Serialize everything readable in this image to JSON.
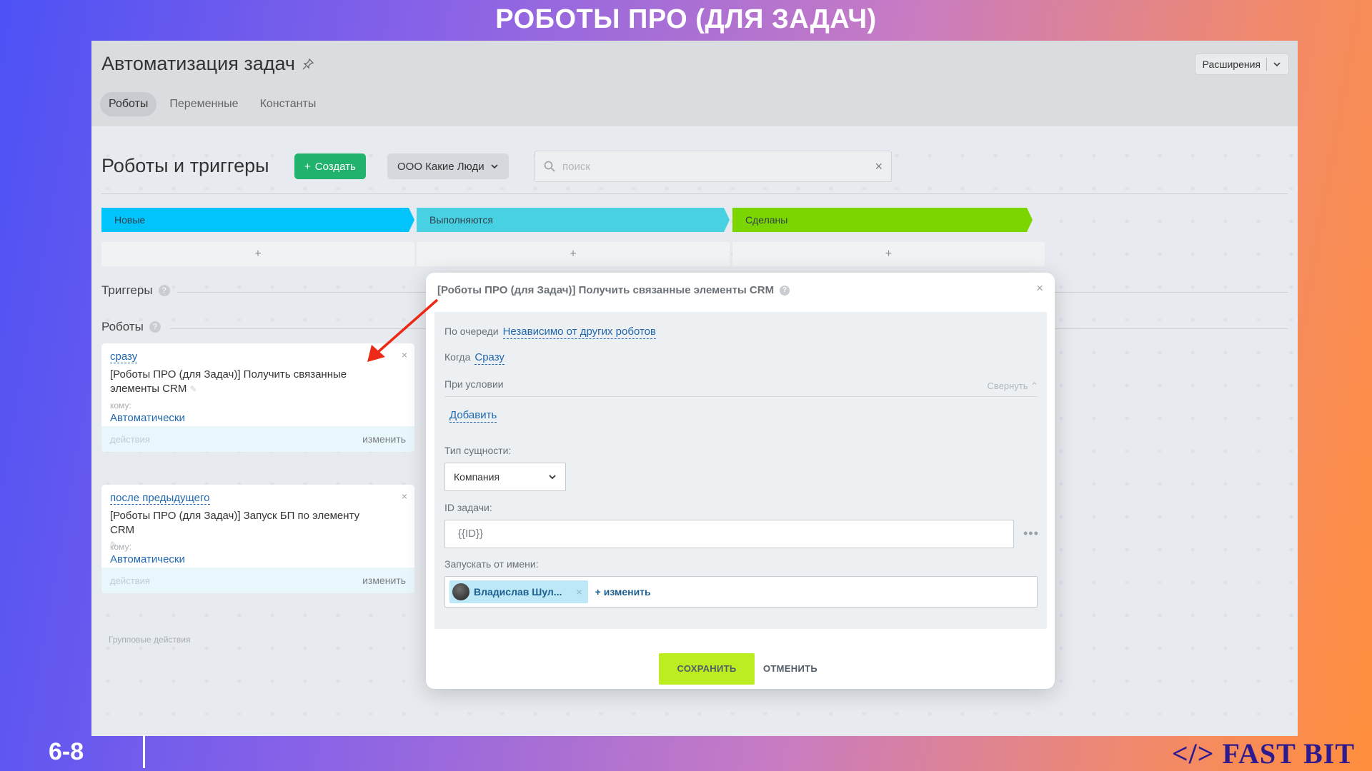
{
  "slide": {
    "title": "РОБОТЫ ПРО (ДЛЯ ЗАДАЧ)",
    "page_number": "6-8",
    "brand": "</> FAST BIT"
  },
  "header": {
    "title": "Автоматизация задач",
    "pin_icon": "pin-icon",
    "extensions_label": "Расширения"
  },
  "tabs": [
    {
      "label": "Роботы",
      "active": true
    },
    {
      "label": "Переменные"
    },
    {
      "label": "Константы"
    }
  ],
  "toolbar": {
    "heading": "Роботы и триггеры",
    "create_label": "Создать",
    "company_label": "ООО Какие Люди",
    "search_placeholder": "поиск"
  },
  "stages": [
    {
      "label": "Новые",
      "color": "#00c4fb"
    },
    {
      "label": "Выполняются",
      "color": "#47d1e2"
    },
    {
      "label": "Сделаны",
      "color": "#7bd500"
    }
  ],
  "add_symbol": "+",
  "sections": {
    "triggers": "Триггеры",
    "robots": "Роботы",
    "group_actions": "Групповые действия"
  },
  "robots": [
    {
      "when": "сразу",
      "name": "[Роботы ПРО (для Задач)] Получить связанные элементы CRM",
      "to_label": "кому:",
      "assignee": "Автоматически",
      "actions_label": "действия",
      "edit_label": "изменить"
    },
    {
      "when": "после предыдущего",
      "name": "[Роботы ПРО (для Задач)] Запуск БП по элементу CRM",
      "to_label": "кому:",
      "assignee": "Автоматически",
      "actions_label": "действия",
      "edit_label": "изменить"
    }
  ],
  "modal": {
    "title": "[Роботы ПРО (для Задач)] Получить связанные элементы CRM",
    "queue_label": "По очереди",
    "queue_value": "Независимо от других роботов",
    "when_label": "Когда",
    "when_value": "Сразу",
    "condition_label": "При условии",
    "collapse_label": "Свернуть",
    "add_label": "Добавить",
    "entity_type_label": "Тип сущности:",
    "entity_type_value": "Компания",
    "task_id_label": "ID задачи:",
    "task_id_value": "{{ID}}",
    "run_as_label": "Запускать от имени:",
    "run_as_user": "Владислав Шул...",
    "change_label": "изменить",
    "save_label": "СОХРАНИТЬ",
    "cancel_label": "ОТМЕНИТЬ"
  }
}
